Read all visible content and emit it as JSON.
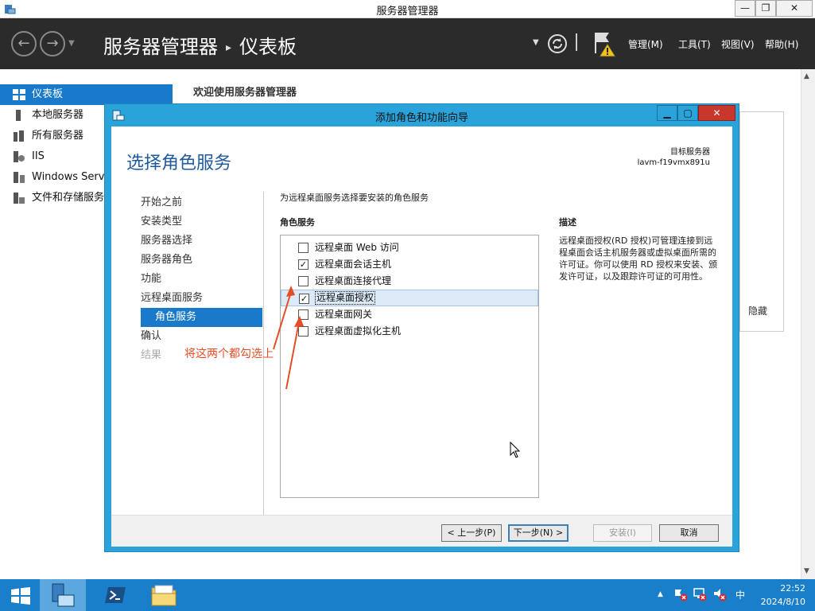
{
  "window": {
    "title": "服务器管理器",
    "min": "—",
    "max": "❐",
    "close": "✕"
  },
  "header": {
    "breadcrumb_app": "服务器管理器",
    "breadcrumb_sep": "▸",
    "breadcrumb_page": "仪表板",
    "menus": [
      "管理(M)",
      "工具(T)",
      "视图(V)",
      "帮助(H)"
    ]
  },
  "sidebar": {
    "items": [
      {
        "label": "仪表板",
        "icon": "dashboard-icon"
      },
      {
        "label": "本地服务器",
        "icon": "server-icon"
      },
      {
        "label": "所有服务器",
        "icon": "servers-icon"
      },
      {
        "label": "IIS",
        "icon": "iis-icon"
      },
      {
        "label": "Windows Server Update Services",
        "icon": "wsus-icon"
      },
      {
        "label": "文件和存储服务",
        "icon": "storage-icon"
      }
    ]
  },
  "main": {
    "welcome": "欢迎使用服务器管理器",
    "hide_label": "隐藏"
  },
  "dialog": {
    "title": "添加角色和功能向导",
    "heading": "选择角色服务",
    "target_label": "目标服务器",
    "target_server": "lavm-f19vmx891u",
    "steps": [
      {
        "label": "开始之前",
        "state": "normal"
      },
      {
        "label": "安装类型",
        "state": "normal"
      },
      {
        "label": "服务器选择",
        "state": "normal"
      },
      {
        "label": "服务器角色",
        "state": "normal"
      },
      {
        "label": "功能",
        "state": "normal"
      },
      {
        "label": "远程桌面服务",
        "state": "normal"
      },
      {
        "label": "角色服务",
        "state": "active"
      },
      {
        "label": "确认",
        "state": "normal"
      },
      {
        "label": "结果",
        "state": "disabled"
      }
    ],
    "instruction": "为远程桌面服务选择要安装的角色服务",
    "roles_header": "角色服务",
    "roles": [
      {
        "label": "远程桌面 Web 访问",
        "checked": false,
        "selected": false
      },
      {
        "label": "远程桌面会话主机",
        "checked": true,
        "selected": false
      },
      {
        "label": "远程桌面连接代理",
        "checked": false,
        "selected": false
      },
      {
        "label": "远程桌面授权",
        "checked": true,
        "selected": true
      },
      {
        "label": "远程桌面网关",
        "checked": false,
        "selected": false
      },
      {
        "label": "远程桌面虚拟化主机",
        "checked": false,
        "selected": false
      }
    ],
    "description_header": "描述",
    "description": "远程桌面授权(RD 授权)可管理连接到远程桌面会话主机服务器或虚拟桌面所需的许可证。你可以使用 RD 授权来安装、颁发许可证，以及跟踪许可证的可用性。",
    "annotation": "将这两个都勾选上",
    "buttons": {
      "prev": "< 上一步(P)",
      "next": "下一步(N) >",
      "install": "安装(I)",
      "cancel": "取消"
    }
  },
  "taskbar": {
    "time": "22:52",
    "date": "2024/8/10",
    "ime": "中"
  },
  "colors": {
    "accent": "#1979ca",
    "dialog_frame": "#29a3d9",
    "header_bg": "#2b2b2b",
    "annotation": "#e54d26"
  }
}
